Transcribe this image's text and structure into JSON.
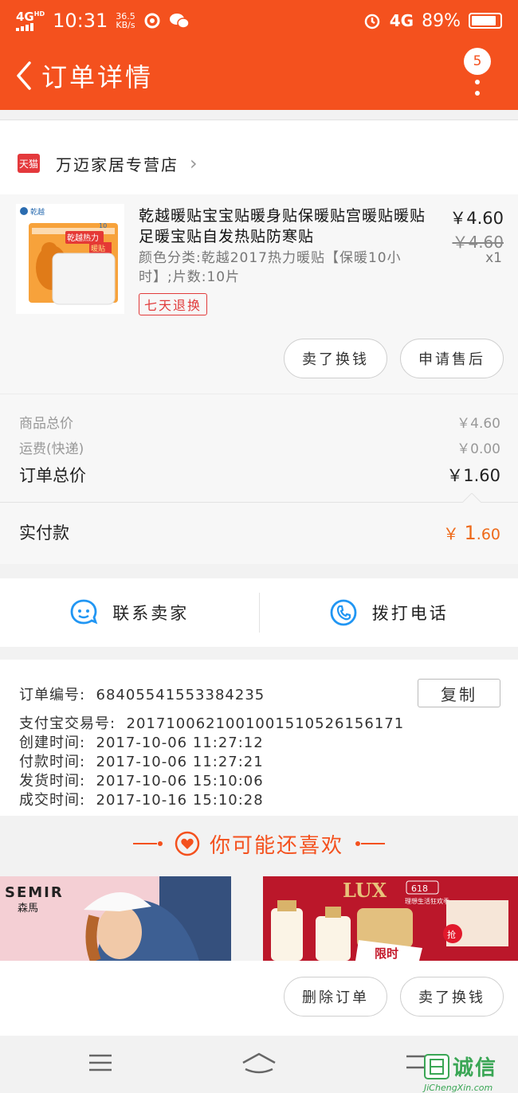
{
  "status": {
    "network": "4G",
    "network_sup": "HD",
    "time": "10:31",
    "speed": "36.5",
    "speed_unit": "KB/s",
    "net_right": "4G",
    "battery": "89%"
  },
  "header": {
    "title": "订单详情",
    "badge_count": "5"
  },
  "store": {
    "tmall_label": "天猫",
    "name": "万迈家居专营店"
  },
  "product": {
    "name": "乾越暖贴宝宝贴暖身贴保暖贴宫暖贴暖贴足暖宝贴自发热贴防寒贴",
    "spec": "颜色分类:乾越2017热力暖贴【保暖10小时】;片数:10片",
    "tag": "七天退换",
    "price": "￥4.60",
    "original_price": "￥4.60",
    "quantity": "x1",
    "thumb_brand": "乾越",
    "thumb_banner": "乾越热力",
    "thumb_sub": "暖贴",
    "thumb_badge": "10"
  },
  "actions": {
    "sell": "卖了换钱",
    "after_sale": "申请售后",
    "delete_order": "删除订单",
    "sell_bottom": "卖了换钱"
  },
  "summary": {
    "goods_total_label": "商品总价",
    "goods_total": "￥4.60",
    "shipping_label": "运费(快递)",
    "shipping": "￥0.00",
    "order_total_label": "订单总价",
    "order_total": "￥1.60",
    "paid_label": "实付款",
    "paid_symbol": "￥",
    "paid_int": "1",
    "paid_dec": ".60"
  },
  "contact": {
    "seller": "联系卖家",
    "call": "拨打电话"
  },
  "info": {
    "order_no_label": "订单编号:",
    "order_no": "68405541553384235",
    "copy": "复制",
    "alipay_label": "支付宝交易号:",
    "alipay_no": "2017100621001001510526156171",
    "created_label": "创建时间:",
    "created": "2017-10-06 11:27:12",
    "paid_label": "付款时间:",
    "paid": "2017-10-06 11:27:21",
    "shipped_label": "发货时间:",
    "shipped": "2017-10-06 15:10:06",
    "done_label": "成交时间:",
    "done": "2017-10-16 15:10:28"
  },
  "recommend": {
    "title": "你可能还喜欢",
    "ad1_brand": "SEMIR",
    "ad1_brand_cn": "森馬",
    "ad2_brand": "LUX",
    "ad2_tag": "618",
    "ad2_sub": "理想生活狂欢季",
    "ad2_promo": "限时",
    "ad2_grab": "抢"
  },
  "watermark": {
    "text": "诚信",
    "url": "JiChengXin.com"
  },
  "colors": {
    "accent": "#f4511e",
    "price_orange": "#ee6a1a",
    "tag_red": "#e13b3b",
    "icon_blue": "#2196f3"
  }
}
